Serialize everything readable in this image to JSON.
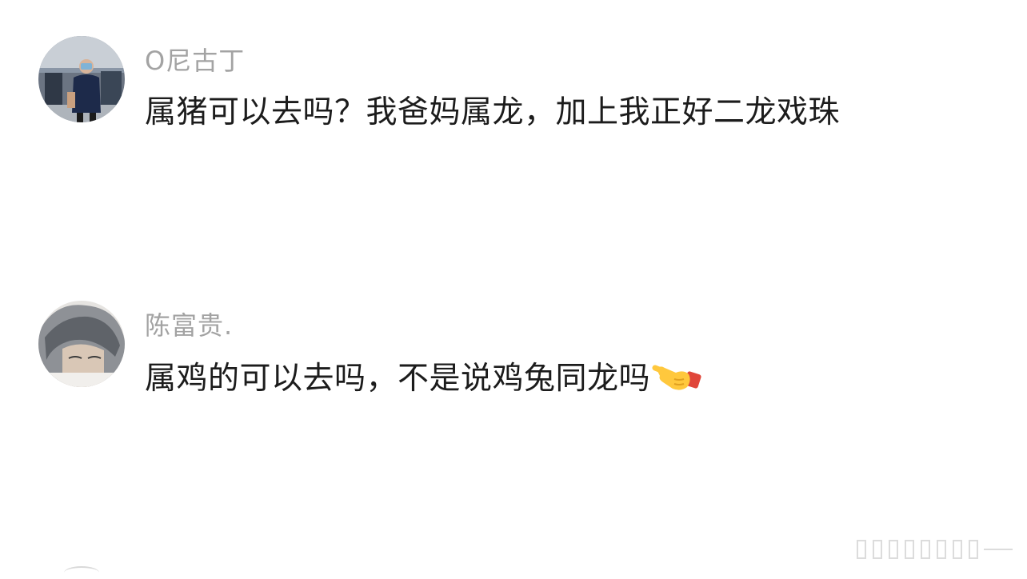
{
  "comments": [
    {
      "username": "O尼古丁",
      "text": "属猪可以去吗？我爸妈属龙，加上我正好二龙戏珠",
      "avatar_icon": "user-photo-airport"
    },
    {
      "username": "陈富贵.",
      "text": "属鸡的可以去吗，不是说鸡兔同龙吗",
      "emoji_icon": "backhand-index-pointing-left-emoji",
      "avatar_icon": "user-photo-gray-hair"
    }
  ],
  "colors": {
    "username": "#a3a3a3",
    "text": "#1c1c1c",
    "background": "#ffffff"
  }
}
